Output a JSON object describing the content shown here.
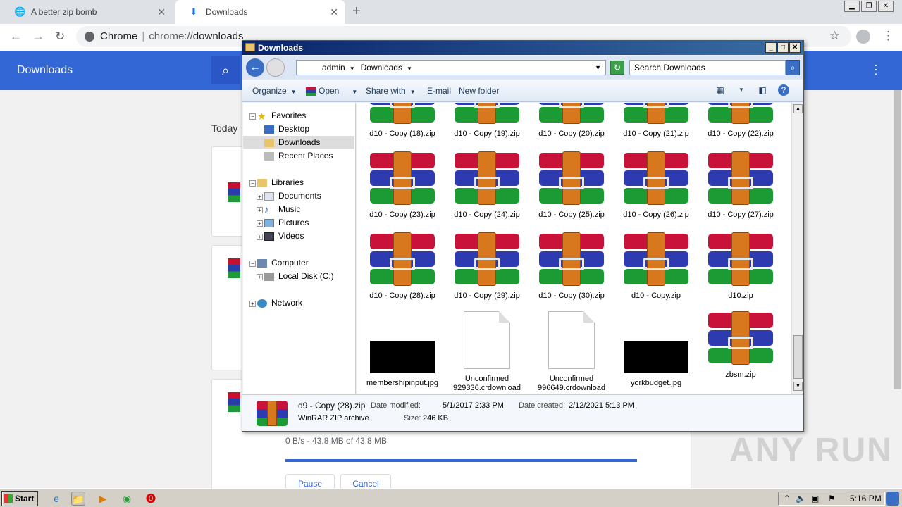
{
  "chrome": {
    "tabs": [
      {
        "label": "A better zip bomb",
        "icon": "globe-icon"
      },
      {
        "label": "Downloads",
        "icon": "download-icon"
      }
    ],
    "omnibox": {
      "site": "Chrome",
      "scheme": "chrome://",
      "path": "downloads"
    }
  },
  "downloads_page": {
    "title": "Downloads",
    "section": "Today",
    "active_download": {
      "progress_text": "0 B/s - 43.8 MB of 43.8 MB",
      "progress": 1.0,
      "buttons": {
        "pause": "Pause",
        "cancel": "Cancel"
      }
    }
  },
  "watermark": "ANY RUN",
  "explorer": {
    "title": "Downloads",
    "address": [
      "admin",
      "Downloads"
    ],
    "search_placeholder": "Search Downloads",
    "commands": {
      "organize": "Organize",
      "open": "Open",
      "share": "Share with",
      "email": "E-mail",
      "new_folder": "New folder"
    },
    "nav": {
      "favorites": "Favorites",
      "desktop": "Desktop",
      "downloads": "Downloads",
      "recent": "Recent Places",
      "libraries": "Libraries",
      "documents": "Documents",
      "music": "Music",
      "pictures": "Pictures",
      "videos": "Videos",
      "computer": "Computer",
      "local_disk": "Local Disk (C:)",
      "network": "Network"
    },
    "files": {
      "row0": [
        "d10 - Copy (18).zip",
        "d10 - Copy (19).zip",
        "d10 - Copy (20).zip",
        "d10 - Copy (21).zip",
        "d10 - Copy (22).zip"
      ],
      "row1": [
        "d10 - Copy (23).zip",
        "d10 - Copy (24).zip",
        "d10 - Copy (25).zip",
        "d10 - Copy (26).zip",
        "d10 - Copy (27).zip"
      ],
      "row2": [
        "d10 - Copy (28).zip",
        "d10 - Copy (29).zip",
        "d10 - Copy (30).zip",
        "d10 - Copy.zip",
        "d10.zip"
      ],
      "row3": [
        "membershipinput.jpg",
        "Unconfirmed 929336.crdownload",
        "Unconfirmed 996649.crdownload",
        "yorkbudget.jpg",
        "zbsm.zip"
      ]
    },
    "details": {
      "name": "d9 - Copy (28).zip",
      "type": "WinRAR ZIP archive",
      "modified_label": "Date modified:",
      "modified": "5/1/2017 2:33 PM",
      "created_label": "Date created:",
      "created": "2/12/2021 5:13 PM",
      "size_label": "Size:",
      "size": "246 KB"
    }
  },
  "taskbar": {
    "start": "Start",
    "clock": "5:16 PM"
  }
}
